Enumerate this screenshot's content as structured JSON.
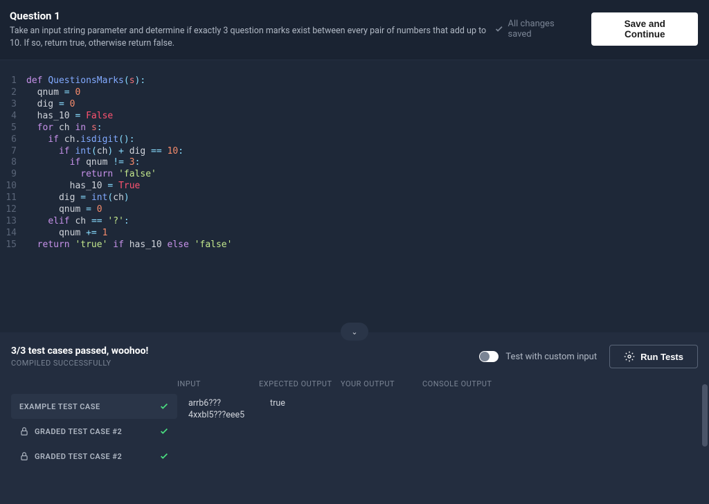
{
  "header": {
    "title": "Question 1",
    "description": "Take an input string parameter and determine if exactly 3 question marks exist between every pair of numbers that add up to 10. If so, return true, otherwise return false.",
    "save_status": "All changes saved",
    "save_button": "Save and Continue"
  },
  "code_lines": [
    {
      "n": 1,
      "tokens": [
        {
          "t": "def ",
          "c": "kw"
        },
        {
          "t": "QuestionsMarks",
          "c": "fn"
        },
        {
          "t": "(",
          "c": "op"
        },
        {
          "t": "s",
          "c": "var"
        },
        {
          "t": "):",
          "c": "op"
        }
      ]
    },
    {
      "n": 2,
      "tokens": [
        {
          "t": "  qnum ",
          "c": ""
        },
        {
          "t": "= ",
          "c": "op"
        },
        {
          "t": "0",
          "c": "num"
        }
      ]
    },
    {
      "n": 3,
      "tokens": [
        {
          "t": "  dig ",
          "c": ""
        },
        {
          "t": "= ",
          "c": "op"
        },
        {
          "t": "0",
          "c": "num"
        }
      ]
    },
    {
      "n": 4,
      "tokens": [
        {
          "t": "  has_10 ",
          "c": ""
        },
        {
          "t": "= ",
          "c": "op"
        },
        {
          "t": "False",
          "c": "bool"
        }
      ]
    },
    {
      "n": 5,
      "tokens": [
        {
          "t": "  ",
          "c": ""
        },
        {
          "t": "for ",
          "c": "kw"
        },
        {
          "t": "ch ",
          "c": ""
        },
        {
          "t": "in ",
          "c": "kw"
        },
        {
          "t": "s",
          "c": "var"
        },
        {
          "t": ":",
          "c": "op"
        }
      ]
    },
    {
      "n": 6,
      "tokens": [
        {
          "t": "    ",
          "c": ""
        },
        {
          "t": "if ",
          "c": "kw"
        },
        {
          "t": "ch.",
          "c": ""
        },
        {
          "t": "isdigit",
          "c": "fn"
        },
        {
          "t": "():",
          "c": "op"
        }
      ]
    },
    {
      "n": 7,
      "tokens": [
        {
          "t": "      ",
          "c": ""
        },
        {
          "t": "if ",
          "c": "kw"
        },
        {
          "t": "int",
          "c": "fn"
        },
        {
          "t": "(",
          "c": "op"
        },
        {
          "t": "ch",
          "c": ""
        },
        {
          "t": ") + ",
          "c": "op"
        },
        {
          "t": "dig ",
          "c": ""
        },
        {
          "t": "== ",
          "c": "op"
        },
        {
          "t": "10",
          "c": "num"
        },
        {
          "t": ":",
          "c": "op"
        }
      ]
    },
    {
      "n": 8,
      "tokens": [
        {
          "t": "        ",
          "c": ""
        },
        {
          "t": "if ",
          "c": "kw"
        },
        {
          "t": "qnum ",
          "c": ""
        },
        {
          "t": "!= ",
          "c": "op"
        },
        {
          "t": "3",
          "c": "num"
        },
        {
          "t": ":",
          "c": "op"
        }
      ]
    },
    {
      "n": 9,
      "tokens": [
        {
          "t": "          ",
          "c": ""
        },
        {
          "t": "return ",
          "c": "kw"
        },
        {
          "t": "'false'",
          "c": "str"
        }
      ]
    },
    {
      "n": 10,
      "tokens": [
        {
          "t": "        has_10 ",
          "c": ""
        },
        {
          "t": "= ",
          "c": "op"
        },
        {
          "t": "True",
          "c": "bool"
        }
      ]
    },
    {
      "n": 11,
      "tokens": [
        {
          "t": "      dig ",
          "c": ""
        },
        {
          "t": "= ",
          "c": "op"
        },
        {
          "t": "int",
          "c": "fn"
        },
        {
          "t": "(",
          "c": "op"
        },
        {
          "t": "ch",
          "c": ""
        },
        {
          "t": ")",
          "c": "op"
        }
      ]
    },
    {
      "n": 12,
      "tokens": [
        {
          "t": "      qnum ",
          "c": ""
        },
        {
          "t": "= ",
          "c": "op"
        },
        {
          "t": "0",
          "c": "num"
        }
      ]
    },
    {
      "n": 13,
      "tokens": [
        {
          "t": "    ",
          "c": ""
        },
        {
          "t": "elif ",
          "c": "kw"
        },
        {
          "t": "ch ",
          "c": ""
        },
        {
          "t": "== ",
          "c": "op"
        },
        {
          "t": "'?'",
          "c": "str"
        },
        {
          "t": ":",
          "c": "op"
        }
      ]
    },
    {
      "n": 14,
      "tokens": [
        {
          "t": "      qnum ",
          "c": ""
        },
        {
          "t": "+= ",
          "c": "op"
        },
        {
          "t": "1",
          "c": "num"
        }
      ]
    },
    {
      "n": 15,
      "tokens": [
        {
          "t": "  ",
          "c": ""
        },
        {
          "t": "return ",
          "c": "kw"
        },
        {
          "t": "'true'",
          "c": "str"
        },
        {
          "t": " ",
          "c": ""
        },
        {
          "t": "if ",
          "c": "kw"
        },
        {
          "t": "has_10 ",
          "c": ""
        },
        {
          "t": "else ",
          "c": "kw"
        },
        {
          "t": "'false'",
          "c": "str"
        }
      ]
    }
  ],
  "results": {
    "pass_status": "3/3 test cases passed, woohoo!",
    "compiled": "COMPILED SUCCESSFULLY",
    "toggle_label": "Test with custom input",
    "run_button": "Run Tests",
    "columns": {
      "input": "INPUT",
      "expected": "EXPECTED OUTPUT",
      "your": "YOUR OUTPUT",
      "console": "CONSOLE OUTPUT"
    },
    "test_cases": [
      {
        "name": "EXAMPLE TEST CASE",
        "locked": false,
        "pass": true,
        "active": true
      },
      {
        "name": "GRADED TEST CASE #2",
        "locked": true,
        "pass": true,
        "active": false
      },
      {
        "name": "GRADED TEST CASE #2",
        "locked": true,
        "pass": true,
        "active": false
      }
    ],
    "active_data": {
      "input": "arrb6???4xxbl5???eee5",
      "expected": "true",
      "your": "",
      "console": ""
    }
  }
}
